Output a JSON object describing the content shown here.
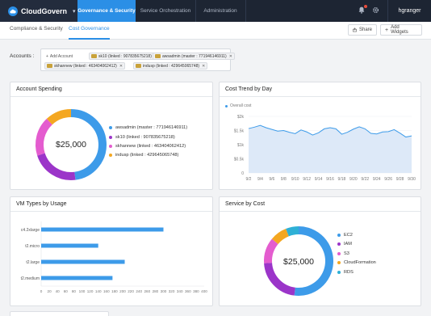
{
  "nav": {
    "brand": "CloudGovern",
    "tabs": [
      "Governance & Security",
      "Service Orchestration",
      "Administration"
    ],
    "user": "hgranger",
    "colors": {
      "bar": "#1d2533",
      "accent": "#2b8fe6"
    }
  },
  "subnav": {
    "tabs": [
      "Compliance & Security",
      "Cost Governance"
    ],
    "share_label": "Share",
    "add_widgets_label": "Add Widgets"
  },
  "accounts": {
    "label": "Accounts :",
    "add_label": "Add Account",
    "chips": [
      "sk10 (linked : 907835675218)",
      "awsadmin (master : 771946146911)",
      "skhannew (linked : 463404062412)",
      "indusp (linked : 429645065748)"
    ]
  },
  "panels": {
    "account_spending": "Account Spending",
    "cost_trend": "Cost Trend by Day",
    "vm_types": "VM Types by Usage",
    "service_cost": "Service by Cost"
  },
  "chart_data": [
    {
      "type": "pie",
      "center_label": "$25,000",
      "categories": [
        "awsadmin (master : 771946146911)",
        "sk10 (linked : 907835675218)",
        "skhannew (linked : 463404062412)",
        "indusp (linked : 429645065748)"
      ],
      "values": [
        48,
        22,
        18,
        12
      ],
      "colors": [
        "#3d9be9",
        "#9b35c9",
        "#e45ccf",
        "#f4a721"
      ]
    },
    {
      "type": "area",
      "legend": [
        "Overall cost"
      ],
      "x": [
        "9/2",
        "9/3",
        "9/4",
        "9/5",
        "9/6",
        "9/7",
        "9/8",
        "9/9",
        "9/10",
        "9/11",
        "9/12",
        "9/13",
        "9/14",
        "9/15",
        "9/16",
        "9/17",
        "9/18",
        "9/19",
        "9/20",
        "9/21",
        "9/22",
        "9/23",
        "9/24",
        "9/25",
        "9/26",
        "9/27",
        "9/28",
        "9/29",
        "9/30"
      ],
      "x_ticks": [
        "9/2",
        "9/4",
        "9/6",
        "9/8",
        "9/10",
        "9/12",
        "9/14",
        "9/16",
        "9/18",
        "9/20",
        "9/22",
        "9/24",
        "9/26",
        "9/28",
        "9/30"
      ],
      "y_ticks": [
        "$2k",
        "$1.5k",
        "$1k",
        "$0.5k",
        "0"
      ],
      "ylim": [
        0,
        2000
      ],
      "series": [
        {
          "values": [
            1570,
            1620,
            1680,
            1600,
            1540,
            1480,
            1500,
            1440,
            1390,
            1520,
            1450,
            1340,
            1420,
            1560,
            1600,
            1560,
            1370,
            1440,
            1550,
            1630,
            1560,
            1400,
            1380,
            1450,
            1460,
            1530,
            1410,
            1270,
            1310
          ]
        }
      ],
      "colors": {
        "line": "#3d9be9",
        "fill": "#dde9f8"
      }
    },
    {
      "type": "bar",
      "orientation": "horizontal",
      "categories": [
        "c4.2xlarge",
        "t2.micro",
        "t2.large",
        "t2.medium"
      ],
      "values": [
        300,
        140,
        205,
        175
      ],
      "x_ticks": [
        "0",
        "20",
        "40",
        "60",
        "80",
        "100",
        "120",
        "140",
        "160",
        "180",
        "200",
        "220",
        "240",
        "260",
        "280",
        "300",
        "320",
        "340",
        "360",
        "380",
        "400"
      ],
      "xlim": [
        0,
        400
      ],
      "color": "#3d9be9"
    },
    {
      "type": "pie",
      "center_label": "$25,000",
      "categories": [
        "EC2",
        "IAM",
        "S3",
        "CloudFormation",
        "RDS"
      ],
      "values": [
        52,
        22,
        12,
        8,
        6
      ],
      "colors": [
        "#3d9be9",
        "#9b35c9",
        "#e45ccf",
        "#f4a721",
        "#2eb0d6"
      ]
    }
  ]
}
